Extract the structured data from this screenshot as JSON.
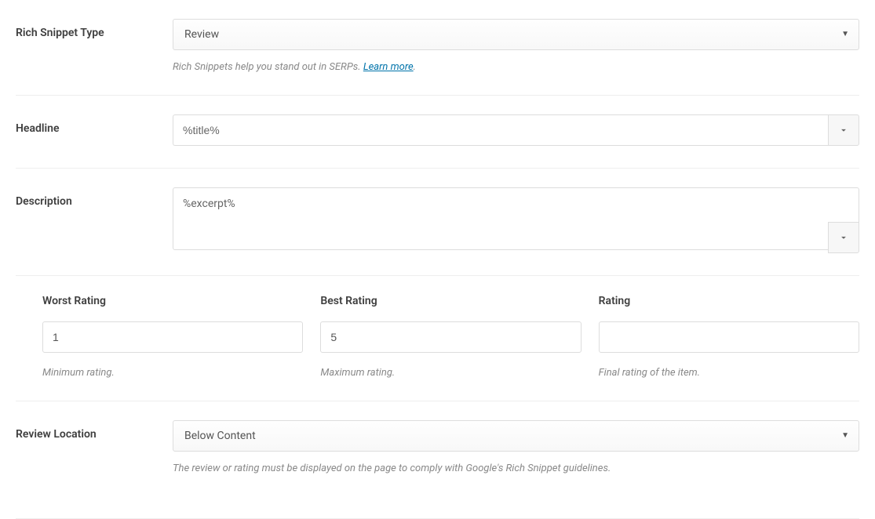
{
  "snippetType": {
    "label": "Rich Snippet Type",
    "value": "Review",
    "helper_prefix": "Rich Snippets help you stand out in SERPs. ",
    "helper_link": "Learn more",
    "helper_suffix": "."
  },
  "headline": {
    "label": "Headline",
    "value": "%title%"
  },
  "description": {
    "label": "Description",
    "value": "%excerpt%"
  },
  "ratings": {
    "worst": {
      "label": "Worst Rating",
      "value": "1",
      "helper": "Minimum rating."
    },
    "best": {
      "label": "Best Rating",
      "value": "5",
      "helper": "Maximum rating."
    },
    "rating": {
      "label": "Rating",
      "value": "",
      "helper": "Final rating of the item."
    }
  },
  "location": {
    "label": "Review Location",
    "value": "Below Content",
    "helper": "The review or rating must be displayed on the page to comply with Google's Rich Snippet guidelines."
  }
}
